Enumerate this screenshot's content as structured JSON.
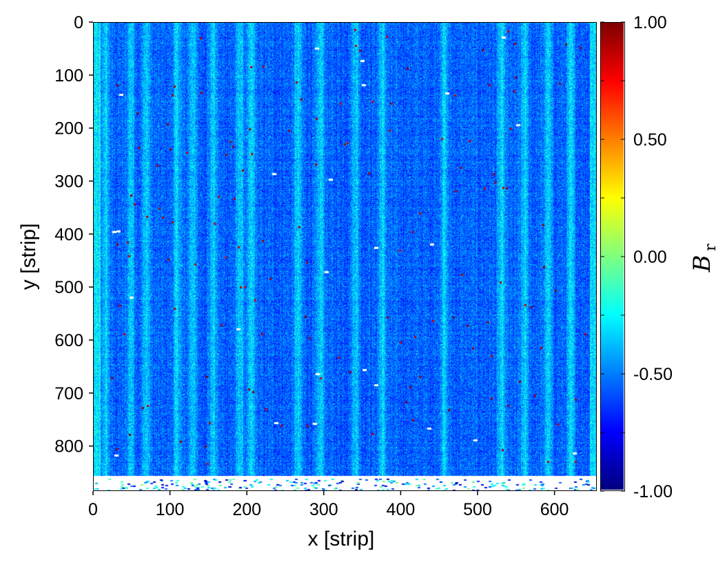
{
  "chart_data": {
    "type": "heatmap",
    "title": "",
    "xlabel": "x [strip]",
    "ylabel": "y [strip]",
    "xlim": [
      0,
      655
    ],
    "ylim": [
      0,
      885
    ],
    "y_inverted": true,
    "x_ticks": [
      "0",
      "100",
      "200",
      "300",
      "400",
      "500",
      "600"
    ],
    "x_tick_values": [
      0,
      100,
      200,
      300,
      400,
      500,
      600
    ],
    "y_ticks": [
      "0",
      "100",
      "200",
      "300",
      "400",
      "500",
      "600",
      "700",
      "800"
    ],
    "y_tick_values": [
      0,
      100,
      200,
      300,
      400,
      500,
      600,
      700,
      800
    ],
    "colorbar": {
      "label": "B",
      "label_subscript": "r",
      "range": [
        -1.0,
        1.0
      ],
      "ticks": [
        "1.00",
        "0.50",
        "0.00",
        "-0.50",
        "-1.00"
      ],
      "tick_values": [
        1.0,
        0.5,
        0.0,
        -0.5,
        -1.0
      ],
      "colormap": "jet"
    },
    "typical_value_range": [
      -0.75,
      -0.2
    ],
    "bright_column_x": [
      15,
      48,
      68,
      108,
      128,
      155,
      190,
      205,
      265,
      295,
      340,
      375,
      455,
      530,
      560,
      590,
      620
    ],
    "grid": false
  }
}
